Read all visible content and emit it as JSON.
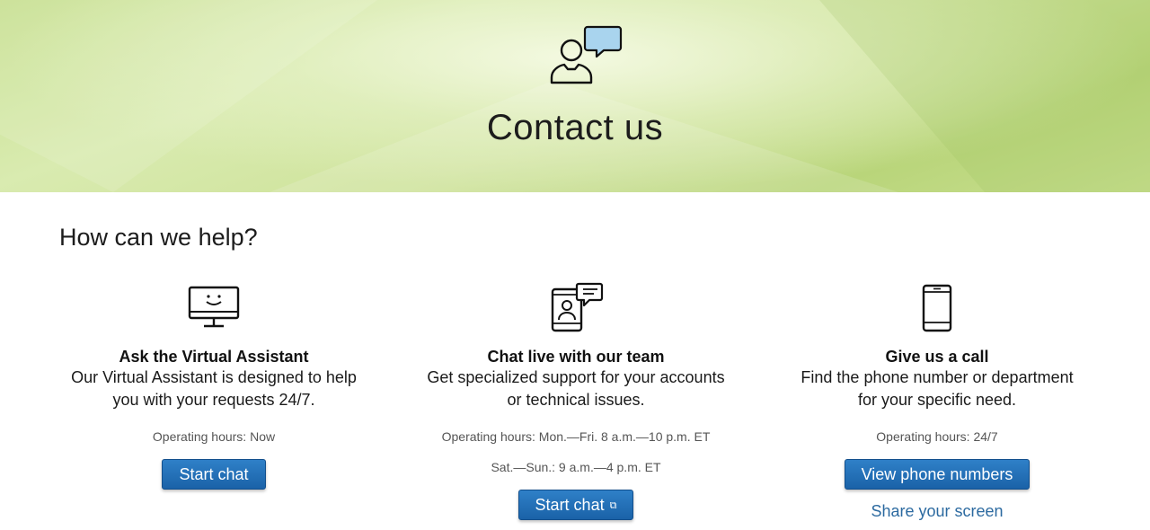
{
  "hero": {
    "title": "Contact us",
    "icon": "person-chat-bubble-icon",
    "accent_color": "#a9d4ee"
  },
  "section": {
    "title": "How can we help?"
  },
  "cards": [
    {
      "icon": "monitor-smiley-icon",
      "heading": "Ask the Virtual Assistant",
      "desc_line1": "Our Virtual Assistant is designed to help",
      "desc_line2": "you with your requests 24/7.",
      "hours_line1": "Operating hours: Now",
      "button_label": "Start chat"
    },
    {
      "icon": "tablet-video-chat-icon",
      "heading": "Chat live with our team",
      "desc_line1": "Get specialized support for your accounts",
      "desc_line2": "or technical issues.",
      "hours_line1": "Operating hours: Mon.—Fri. 8 a.m.—10 p.m. ET",
      "hours_line2": "Sat.—Sun.: 9 a.m.—4 p.m. ET",
      "button_label": "Start chat",
      "button_icon": "popout-window-icon"
    },
    {
      "icon": "mobile-phone-icon",
      "heading": "Give us a call",
      "desc_line1": "Find the phone number or department",
      "desc_line2": "for your specific need.",
      "hours_line1": "Operating hours: 24/7",
      "button_label": "View phone numbers",
      "link_label": "Share your screen"
    }
  ],
  "colors": {
    "button_blue": "#1f6bb3",
    "link_blue": "#2c6aa0",
    "hero_green": "#c6df8e"
  }
}
